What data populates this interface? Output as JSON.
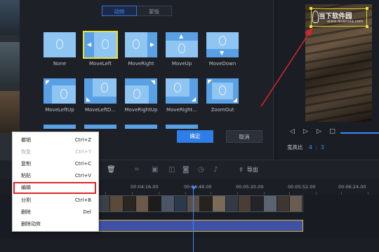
{
  "dialog": {
    "tabs": [
      "动效",
      "蒙版"
    ],
    "effects": [
      "None",
      "MoveLeft",
      "MoveRight",
      "MoveUp",
      "MoveDown",
      "MoveLeftUp",
      "MoveLeftD...",
      "MoveRightUp",
      "MoveRight...",
      "ZoomOut"
    ],
    "ok_label": "确定",
    "cancel_label": "取消"
  },
  "preview": {
    "watermark_title": "当下软件园",
    "watermark_url": "www.downxia.com",
    "ratio_label": "宽高比",
    "ratio_value": "4 : 3"
  },
  "toolbar": {
    "export_label": "导出"
  },
  "ruler": {
    "times": [
      "00:04:16.00",
      "00:04:48.00",
      "00:05:20.00",
      "00:05:52.00",
      "00:06:24.00"
    ]
  },
  "context_menu": {
    "items": [
      {
        "label": "撤销",
        "shortcut": "Ctrl+Z",
        "disabled": false
      },
      {
        "label": "恢复",
        "shortcut": "Ctrl+Y",
        "disabled": true
      },
      {
        "label": "复制",
        "shortcut": "Ctrl+C",
        "disabled": false
      },
      {
        "label": "粘贴",
        "shortcut": "Ctrl+V",
        "disabled": false
      },
      {
        "label": "编辑",
        "shortcut": "",
        "disabled": false
      },
      {
        "label": "分割",
        "shortcut": "Ctrl+B",
        "disabled": false
      },
      {
        "label": "删除",
        "shortcut": "Del",
        "disabled": false
      },
      {
        "label": "删除动效",
        "shortcut": "",
        "disabled": false
      }
    ]
  },
  "colors": {
    "accent": "#2f7ee8",
    "selection": "#e8e23a",
    "highlight_box": "#d8262a",
    "annotation_arrow": "#d8262a"
  }
}
